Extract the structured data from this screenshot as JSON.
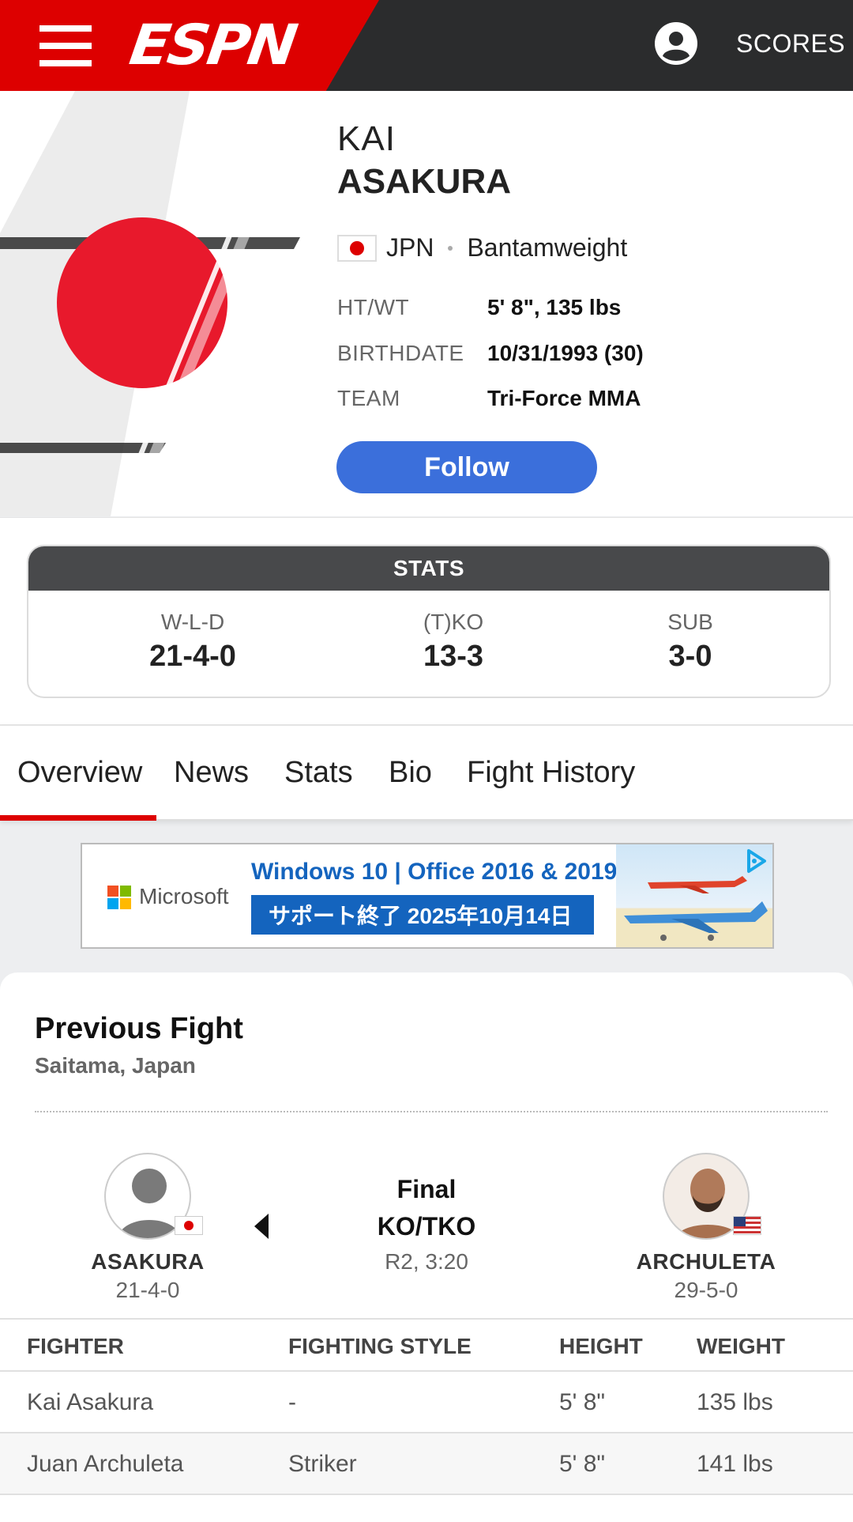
{
  "header": {
    "logo": "ESPN",
    "scores_label": "SCORES"
  },
  "profile": {
    "first_name": "KAI",
    "last_name": "ASAKURA",
    "country": "JPN",
    "weight_class": "Bantamweight",
    "info": [
      {
        "label": "HT/WT",
        "value": "5' 8\", 135 lbs"
      },
      {
        "label": "BIRTHDATE",
        "value": "10/31/1993 (30)"
      },
      {
        "label": "TEAM",
        "value": "Tri-Force MMA"
      }
    ],
    "follow_label": "Follow"
  },
  "stats": {
    "title": "STATS",
    "items": [
      {
        "label": "W-L-D",
        "value": "21-4-0"
      },
      {
        "label": "(T)KO",
        "value": "13-3"
      },
      {
        "label": "SUB",
        "value": "3-0"
      }
    ]
  },
  "tabs": [
    {
      "label": "Overview",
      "active": true
    },
    {
      "label": "News"
    },
    {
      "label": "Stats"
    },
    {
      "label": "Bio"
    },
    {
      "label": "Fight History"
    }
  ],
  "ad": {
    "brand": "Microsoft",
    "line1": "Windows 10 | Office 2016 & 2019",
    "line2": "サポート終了 2025年10月14日"
  },
  "previous_fight": {
    "title": "Previous Fight",
    "location": "Saitama, Japan",
    "fighter1": {
      "name": "ASAKURA",
      "record": "21-4-0"
    },
    "fighter2": {
      "name": "ARCHULETA",
      "record": "29-5-0"
    },
    "status": "Final",
    "method": "KO/TKO",
    "round_time": "R2, 3:20",
    "table": {
      "headers": [
        "FIGHTER",
        "FIGHTING STYLE",
        "HEIGHT",
        "WEIGHT"
      ],
      "rows": [
        [
          "Kai Asakura",
          "-",
          "5' 8\"",
          "135 lbs"
        ],
        [
          "Juan Archuleta",
          "Striker",
          "5' 8\"",
          "141 lbs"
        ]
      ]
    }
  },
  "colors": {
    "espn_red": "#dd0000",
    "header_dark": "#2b2c2d",
    "follow_blue": "#3b6fdb",
    "ad_blue": "#1464be"
  }
}
